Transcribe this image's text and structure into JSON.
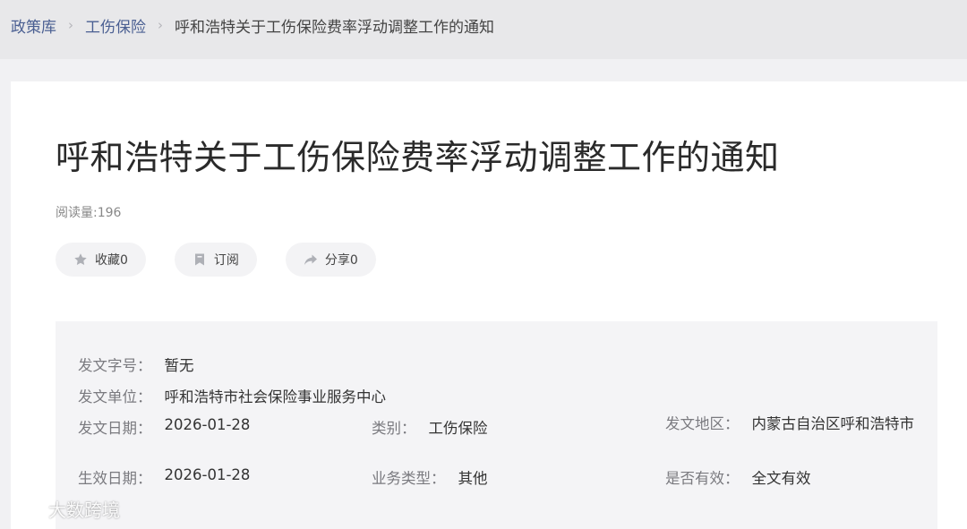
{
  "breadcrumb": {
    "items": [
      "政策库",
      "工伤保险"
    ],
    "current": "呼和浩特关于工伤保险费率浮动调整工作的通知"
  },
  "article": {
    "title": "呼和浩特关于工伤保险费率浮动调整工作的通知",
    "read_count": "阅读量:196"
  },
  "actions": {
    "collect": "收藏0",
    "subscribe": "订阅",
    "share": "分享0"
  },
  "meta": {
    "doc_no_label": "发文字号：",
    "doc_no": "暂无",
    "issuer_label": "发文单位：",
    "issuer": "呼和浩特市社会保险事业服务中心",
    "issue_date_label": "发文日期：",
    "issue_date": "2026-01-28",
    "category_label": "类别：",
    "category": "工伤保险",
    "region_label": "发文地区：",
    "region": "内蒙古自治区呼和浩特市",
    "effective_date_label": "生效日期：",
    "effective_date": "2026-01-28",
    "business_type_label": "业务类型：",
    "business_type": "其他",
    "validity_label": "是否有效：",
    "validity": "全文有效"
  },
  "watermark": {
    "text": "大数跨境"
  },
  "icons": {
    "collect": "star-icon",
    "subscribe": "bookmark-icon",
    "share": "share-arrow-icon",
    "breadcrumb_sep": "chevron-right-icon"
  }
}
